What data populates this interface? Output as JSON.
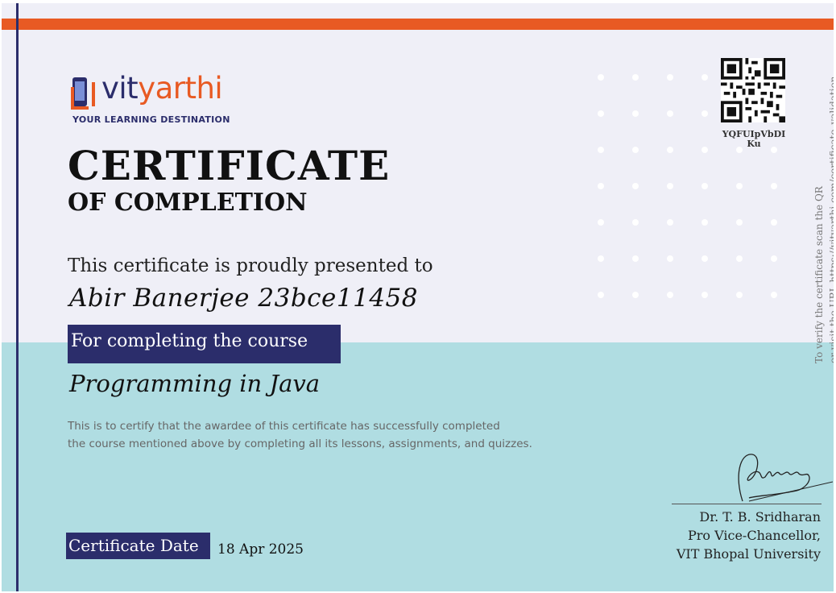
{
  "logo": {
    "brand_prefix": "vit",
    "brand_suffix": "yarthi",
    "tagline": "YOUR LEARNING DESTINATION"
  },
  "certificate": {
    "title": "CERTIFICATE",
    "subtitle": "OF COMPLETION",
    "presented_text": "This certificate is proudly presented to",
    "recipient": "Abir Banerjee 23bce11458",
    "course_label": "For completing the course",
    "course_name": "Programming in Java",
    "description_line1": "This is to certify that the awardee of this certificate has successfully completed",
    "description_line2": "the course mentioned above by  completing all its lessons, assignments, and quizzes.",
    "date_label": "Certificate Date",
    "date_value": "18 Apr 2025"
  },
  "verification": {
    "qr_code_text": "YQFUIpVbDIKu",
    "line1": "To verify the certificate scan the QR",
    "line2": "or visit the URL  https://vityarthi.com/certificate_validation"
  },
  "signatory": {
    "name": "Dr. T. B. Sridharan",
    "designation": "Pro Vice-Chancellor,",
    "institution": "VIT Bhopal University"
  },
  "colors": {
    "accent": "#e85a23",
    "navy": "#2b2d6b",
    "band": "#b0dde2",
    "background": "#efeff7"
  }
}
